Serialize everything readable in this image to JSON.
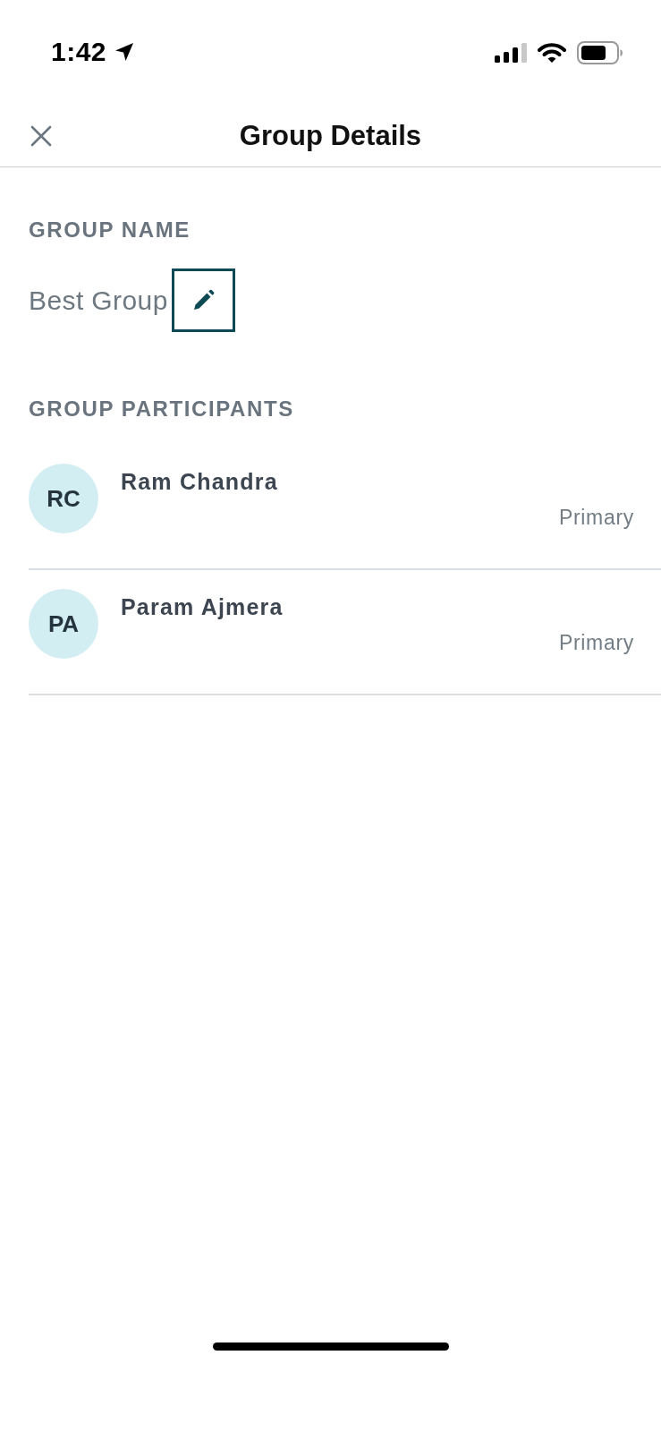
{
  "status_bar": {
    "time": "1:42"
  },
  "nav": {
    "title": "Group Details"
  },
  "group_name": {
    "label": "GROUP NAME",
    "value": "Best Group"
  },
  "participants": {
    "label": "GROUP PARTICIPANTS",
    "items": [
      {
        "initials": "RC",
        "name": "Ram Chandra",
        "role": "Primary"
      },
      {
        "initials": "PA",
        "name": "Param Ajmera",
        "role": "Primary"
      }
    ]
  }
}
